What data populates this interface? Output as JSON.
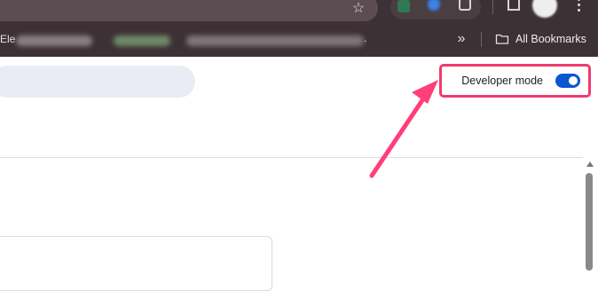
{
  "toolbar": {
    "star_glyph": "☆",
    "overflow_glyph": "»",
    "bookmark_truncated": "Ele"
  },
  "bookmarks_bar": {
    "all_bookmarks_label": "All Bookmarks",
    "blurred_tail": "."
  },
  "extensions_page": {
    "developer_mode_label": "Developer mode",
    "developer_mode_enabled": true
  },
  "colors": {
    "chrome_bg": "#3c3135",
    "toggle_on": "#0b57d0",
    "highlight": "#ef3b6c",
    "search_bg": "#e9ecf5"
  },
  "icons": {
    "bookmark_star": "star-icon",
    "bookmarks_folder": "folder-icon",
    "overflow": "chevrons-right-icon",
    "menu": "kebab-menu-icon"
  }
}
